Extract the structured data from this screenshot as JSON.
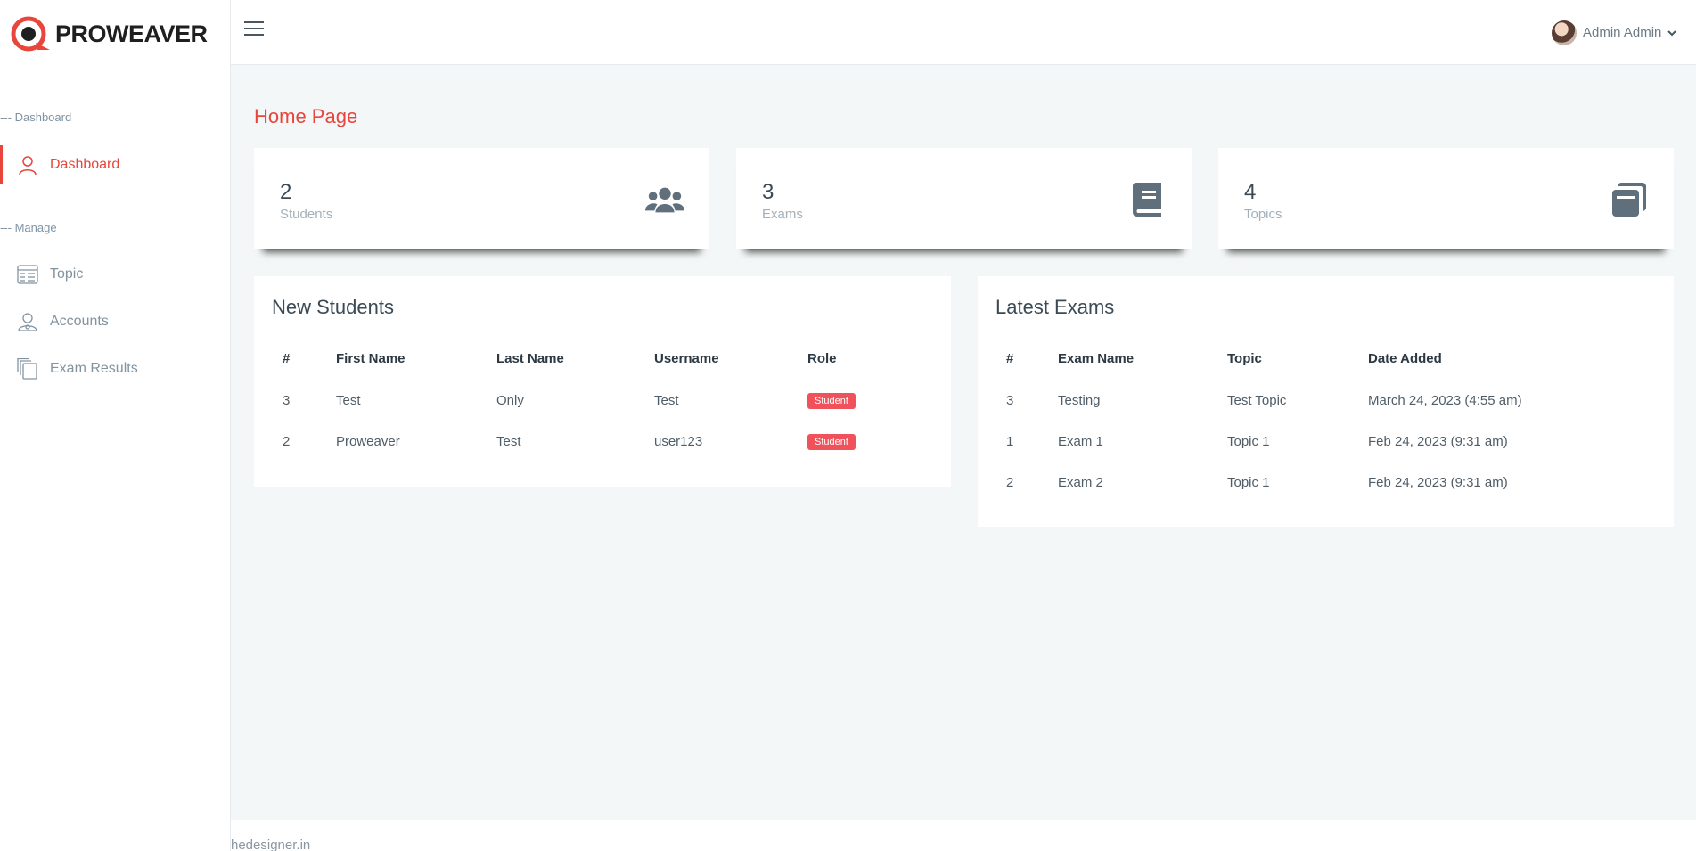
{
  "brand": {
    "name": "PROWEAVER",
    "accent": "#e8453c"
  },
  "sidebar": {
    "sections": [
      {
        "label": "--- Dashboard"
      },
      {
        "label": "--- Manage"
      }
    ],
    "items": [
      {
        "label": "Dashboard",
        "icon": "user-icon",
        "active": true
      },
      {
        "label": "Topic",
        "icon": "list-icon"
      },
      {
        "label": "Accounts",
        "icon": "accounts-icon"
      },
      {
        "label": "Exam Results",
        "icon": "copy-icon"
      }
    ]
  },
  "topbar": {
    "user_name": "Admin Admin"
  },
  "main": {
    "title": "Home Page",
    "stats": [
      {
        "value": "2",
        "label": "Students",
        "icon": "users-icon"
      },
      {
        "value": "3",
        "label": "Exams",
        "icon": "book-icon"
      },
      {
        "value": "4",
        "label": "Topics",
        "icon": "copy-icon"
      }
    ],
    "new_students": {
      "title": "New Students",
      "columns": [
        "#",
        "First Name",
        "Last Name",
        "Username",
        "Role"
      ],
      "rows": [
        [
          "3",
          "Test",
          "Only",
          "Test",
          "Student"
        ],
        [
          "2",
          "Proweaver",
          "Test",
          "user123",
          "Student"
        ]
      ]
    },
    "latest_exams": {
      "title": "Latest Exams",
      "columns": [
        "#",
        "Exam Name",
        "Topic",
        "Date Added"
      ],
      "rows": [
        [
          "3",
          "Testing",
          "Test Topic",
          "March 24, 2023 (4:55 am)"
        ],
        [
          "1",
          "Exam 1",
          "Topic 1",
          "Feb 24, 2023 (9:31 am)"
        ],
        [
          "2",
          "Exam 2",
          "Topic 1",
          "Feb 24, 2023 (9:31 am)"
        ]
      ]
    }
  },
  "footer": {
    "text": "hedesigner.in"
  }
}
